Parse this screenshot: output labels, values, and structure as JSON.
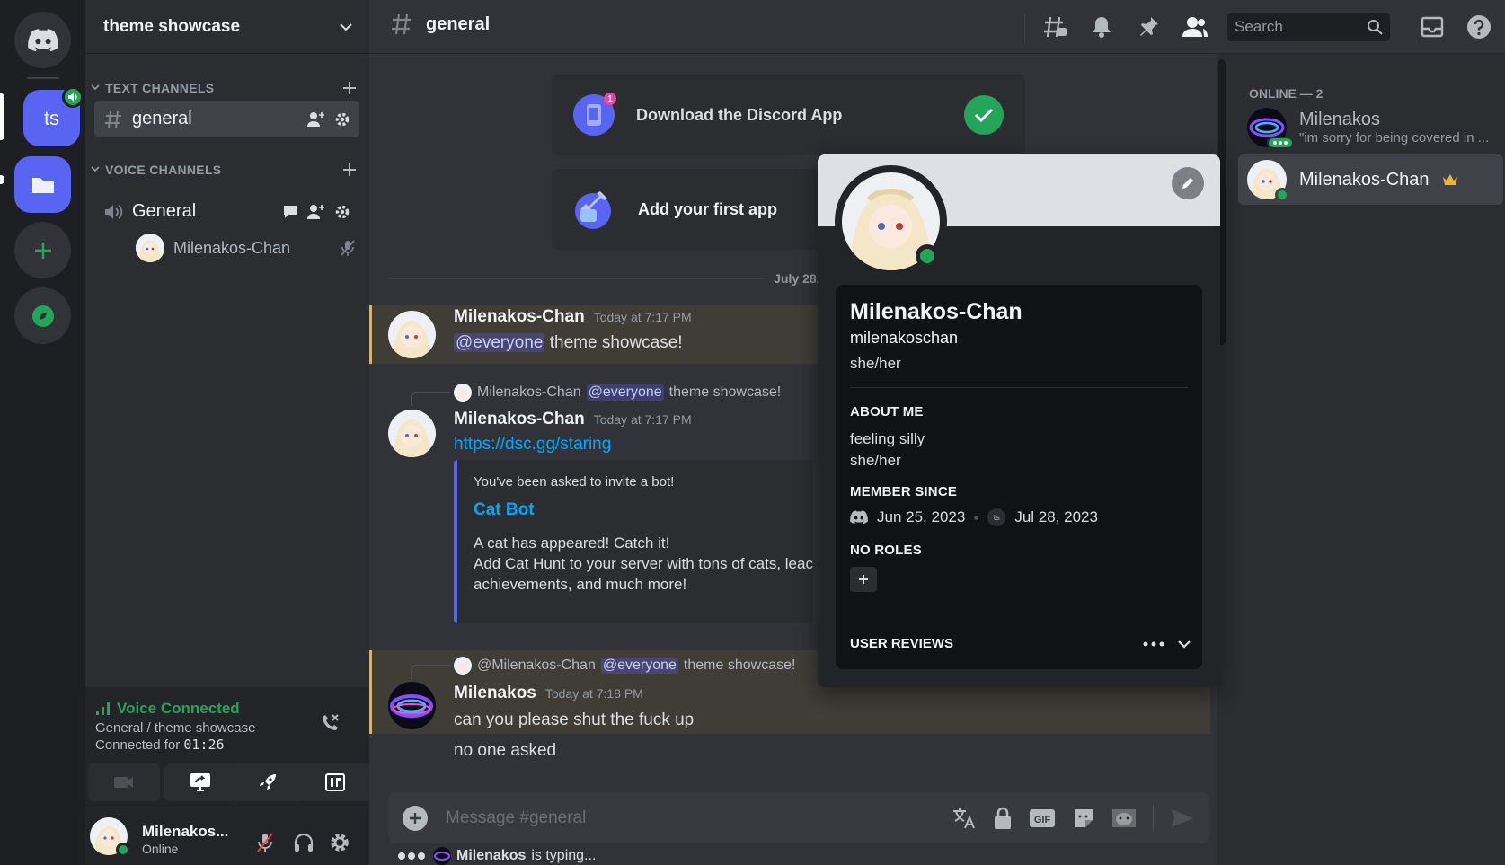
{
  "server": {
    "name": "theme showcase",
    "abbrev": "ts"
  },
  "sidebar": {
    "text_category": "TEXT CHANNELS",
    "voice_category": "VOICE CHANNELS",
    "text_channel": "general",
    "voice_channel": "General",
    "voice_member": "Milenakos-Chan"
  },
  "voice": {
    "title": "Voice Connected",
    "location": "General / theme showcase",
    "connected_label": "Connected for",
    "connected_time": "01:26"
  },
  "user": {
    "name": "Milenakos...",
    "status": "Online"
  },
  "header": {
    "channel": "general",
    "search_placeholder": "Search"
  },
  "cards": {
    "download": "Download the Discord App",
    "add_app": "Add your first app"
  },
  "date_divider": "July 28, 20",
  "messages": [
    {
      "author": "Milenakos-Chan",
      "time": "Today at 7:17 PM",
      "mention": "@everyone",
      "text": "theme showcase!"
    },
    {
      "reply_author": "Milenakos-Chan",
      "reply_mention": "@everyone",
      "reply_text": "theme showcase!",
      "author": "Milenakos-Chan",
      "time": "Today at 7:17 PM",
      "link": "https://dsc.gg/staring",
      "embed": {
        "pre": "You've been asked to invite a bot!",
        "title": "Cat Bot",
        "line1": "A cat has appeared! Catch it!",
        "line2": "Add Cat Hunt to your server with tons of cats, leac",
        "line3": "achievements, and much more!"
      }
    },
    {
      "reply_author": "@Milenakos-Chan",
      "reply_mention": "@everyone",
      "reply_text": "theme showcase!",
      "author": "Milenakos",
      "time": "Today at 7:18 PM",
      "text": "can you please shut the fuck up",
      "text2": "no one asked"
    }
  ],
  "composer": {
    "placeholder": "Message #general"
  },
  "typing": {
    "name": "Milenakos",
    "suffix": "is typing..."
  },
  "members": {
    "header": "ONLINE — 2",
    "list": [
      {
        "name": "Milenakos",
        "status": "\"im sorry for being covered in ..."
      },
      {
        "name": "Milenakos-Chan",
        "status": ""
      }
    ]
  },
  "profile": {
    "display_name": "Milenakos-Chan",
    "username": "milenakoschan",
    "pronouns": "she/her",
    "about_heading": "ABOUT ME",
    "about_line1": "feeling silly",
    "about_line2": "she/her",
    "member_since_heading": "MEMBER SINCE",
    "discord_since": "Jun 25, 2023",
    "server_badge": "ts",
    "server_since": "Jul 28, 2023",
    "roles_heading": "NO ROLES",
    "reviews_heading": "USER REVIEWS"
  },
  "colors": {
    "accent": "#5865f2",
    "online": "#23a55a",
    "mention_highlight": "#f0b232",
    "link": "#00a8fc"
  }
}
